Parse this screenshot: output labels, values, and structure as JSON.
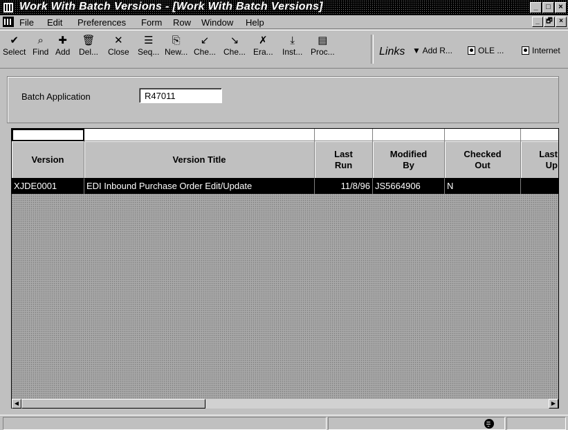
{
  "window": {
    "title": "Work With Batch Versions - [Work With Batch Versions]",
    "controls": [
      "_",
      "□",
      "×"
    ],
    "mdi_controls": [
      "_",
      "🗗",
      "×"
    ]
  },
  "menu": [
    "File",
    "Edit",
    "Preferences",
    "Form",
    "Row",
    "Window",
    "Help"
  ],
  "toolbar": {
    "buttons": [
      {
        "label": "Select",
        "icon": "checkmark-icon",
        "glyph": "✔"
      },
      {
        "label": "Find",
        "icon": "find-icon",
        "glyph": "⌕"
      },
      {
        "label": "Add",
        "icon": "add-icon",
        "glyph": "✚"
      },
      {
        "label": "Del...",
        "icon": "trash-icon",
        "glyph": "🗑"
      },
      {
        "label": "Close",
        "icon": "close-icon",
        "glyph": "✕"
      },
      {
        "label": "Seq...",
        "icon": "sequence-icon",
        "glyph": "☰"
      },
      {
        "label": "New...",
        "icon": "new-icon",
        "glyph": "⎘"
      },
      {
        "label": "Che...",
        "icon": "check-in-icon",
        "glyph": "↙"
      },
      {
        "label": "Che...",
        "icon": "check-out-icon",
        "glyph": "↘"
      },
      {
        "label": "Era...",
        "icon": "erase-icon",
        "glyph": "✗"
      },
      {
        "label": "Inst...",
        "icon": "install-icon",
        "glyph": "⤓"
      },
      {
        "label": "Proc...",
        "icon": "processing-icon",
        "glyph": "▤"
      }
    ],
    "links_label": "Links",
    "add_r": "Add R...",
    "ole": "OLE ...",
    "internet": "Internet"
  },
  "criteria": {
    "label": "Batch Application",
    "value": "R47011"
  },
  "grid": {
    "columns": [
      {
        "line1": "Version",
        "line2": ""
      },
      {
        "line1": "Version Title",
        "line2": ""
      },
      {
        "line1": "Last",
        "line2": "Run"
      },
      {
        "line1": "Modified",
        "line2": "By"
      },
      {
        "line1": "Checked",
        "line2": "Out"
      },
      {
        "line1": "Last",
        "line2": "Up"
      }
    ],
    "rows": [
      {
        "version": "XJDE0001",
        "title": "EDI Inbound Purchase Order Edit/Update",
        "last_run": "11/8/96",
        "modified_by": "JS5664906",
        "checked_out": "N",
        "last_up": ""
      }
    ]
  }
}
